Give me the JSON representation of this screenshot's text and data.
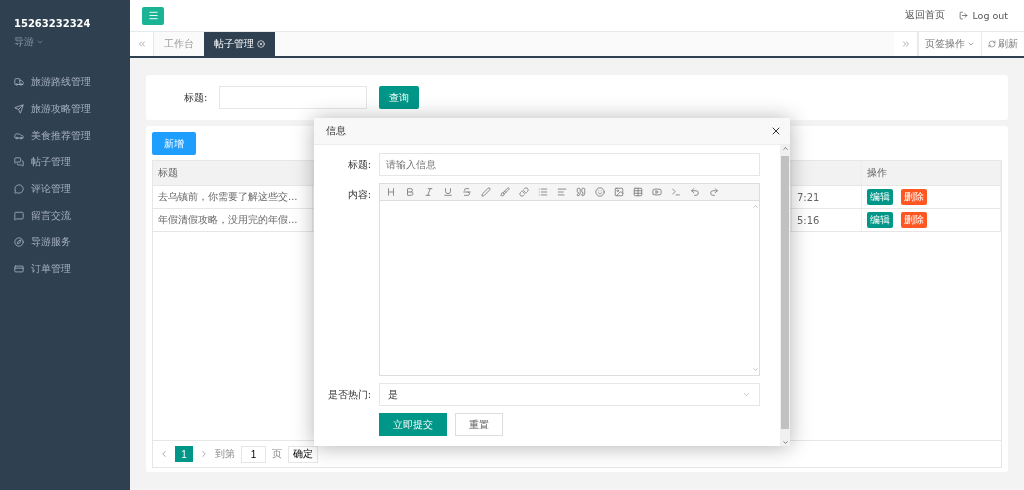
{
  "sidebar": {
    "user": "15263232324",
    "role": "导游",
    "items": [
      {
        "label": "旅游路线管理"
      },
      {
        "label": "旅游攻略管理"
      },
      {
        "label": "美食推荐管理"
      },
      {
        "label": "帖子管理"
      },
      {
        "label": "评论管理"
      },
      {
        "label": "留言交流"
      },
      {
        "label": "导游服务"
      },
      {
        "label": "订单管理"
      }
    ]
  },
  "header": {
    "links": [
      "返回首页",
      "Log out"
    ]
  },
  "tabs": [
    {
      "label": "工作台",
      "selected": false,
      "closable": false
    },
    {
      "label": "帖子管理",
      "selected": true,
      "closable": true
    }
  ],
  "tab_tools": [
    "页签操作",
    "刷新"
  ],
  "search": {
    "label": "标题:",
    "button": "查询"
  },
  "table": {
    "add_button": "新增",
    "columns": [
      "标题",
      "操作"
    ],
    "rows": [
      {
        "title": "去乌镇前，你需要了解这些交...",
        "column_3": "7:21",
        "actions": [
          "编辑",
          "删除"
        ]
      },
      {
        "title": "年假清假攻略，没用完的年假...",
        "column_3": "5:16",
        "actions": [
          "编辑",
          "删除"
        ]
      }
    ],
    "pagination": {
      "pages": [
        {
          "label": "1",
          "selected": true
        }
      ],
      "goto_label": "到第",
      "goto_value": "1",
      "page_label": "页",
      "confirm": "确定"
    }
  },
  "modal": {
    "title": "信息",
    "fields": [
      {
        "kind": "text",
        "label": "标题:",
        "placeholder": "请输入信息"
      },
      {
        "kind": "editor",
        "label": "内容:"
      },
      {
        "kind": "select",
        "label": "是否热门:",
        "value": "是"
      }
    ],
    "buttons": [
      {
        "label": "立即提交",
        "primary": true
      },
      {
        "label": "重置",
        "primary": false
      }
    ]
  }
}
